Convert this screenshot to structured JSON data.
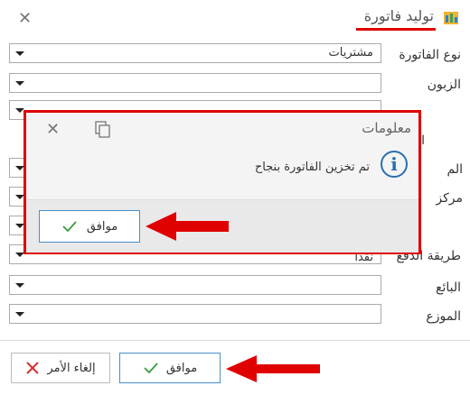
{
  "header": {
    "title": "توليد فاتورة"
  },
  "form": {
    "invoice_type_label": "نوع الفاتورة",
    "invoice_type_value": "مشتريات",
    "customer_label": "الزبون",
    "hidden_label_1": "ا",
    "hidden_label_2": "الم",
    "hidden_label_3": "مركز",
    "payment_method_label": "طريقة الدفع",
    "payment_method_value": "نقدا",
    "seller_label": "البائع",
    "distributor_label": "الموزع"
  },
  "buttons": {
    "ok_label": "موافق",
    "cancel_label": "إلغاء الأمر"
  },
  "dialog": {
    "title": "معلومات",
    "message": "تم تخزين الفاتورة بنجاح",
    "ok_label": "موافق"
  },
  "colors": {
    "annotation_red": "#e00000",
    "check_green": "#3a9a3a",
    "cancel_red": "#d63030",
    "info_blue": "#2a6fb0"
  }
}
